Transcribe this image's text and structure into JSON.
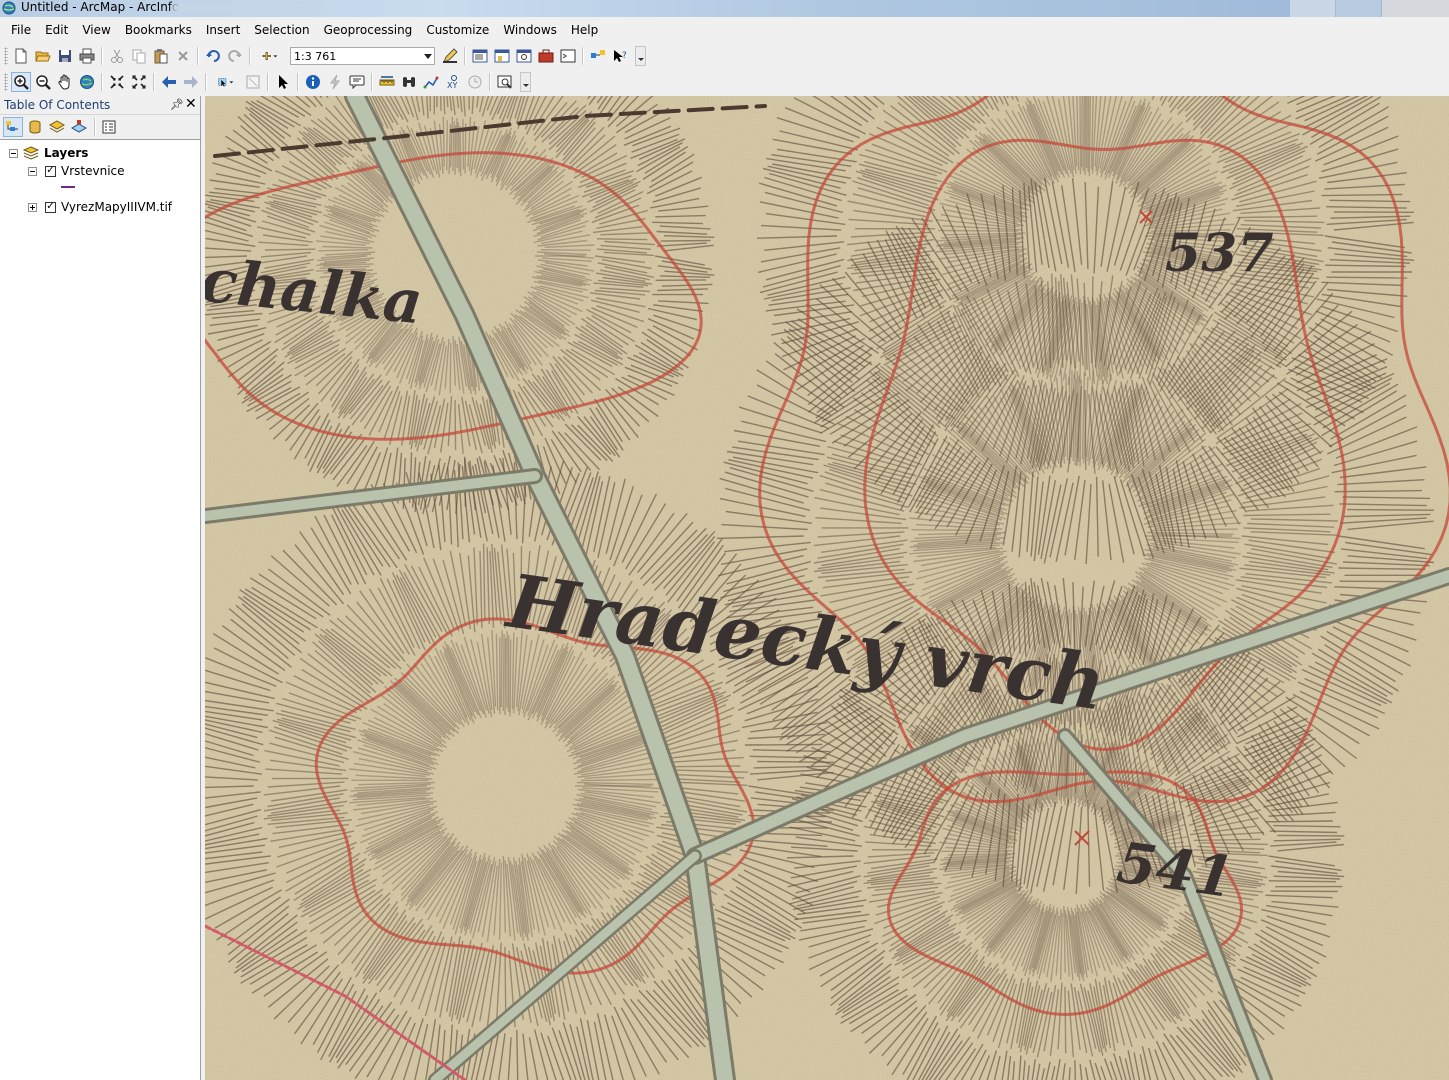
{
  "window": {
    "title": "Untitled - ArcMap - ArcInfo"
  },
  "menu": [
    "File",
    "Edit",
    "View",
    "Bookmarks",
    "Insert",
    "Selection",
    "Geoprocessing",
    "Customize",
    "Windows",
    "Help"
  ],
  "standard_toolbar": {
    "scale_value": "1:3 761"
  },
  "toc": {
    "title": "Table Of Contents",
    "root": {
      "label": "Layers"
    },
    "layers": [
      {
        "label": "Vrstevnice",
        "checked": true,
        "expanded": true,
        "symbol_color": "#6b2c8e"
      },
      {
        "label": "VyrezMapyIIIVM.tif",
        "checked": true,
        "expanded": false
      }
    ]
  },
  "map": {
    "labels": [
      "Hradecký vrch",
      "537",
      "541"
    ]
  },
  "colors": {
    "paper": "#d9cca7",
    "hachure": "#5a4538",
    "contour": "#c4483a",
    "road": "#b8c2ac",
    "toc_title": "#1f3f74"
  }
}
